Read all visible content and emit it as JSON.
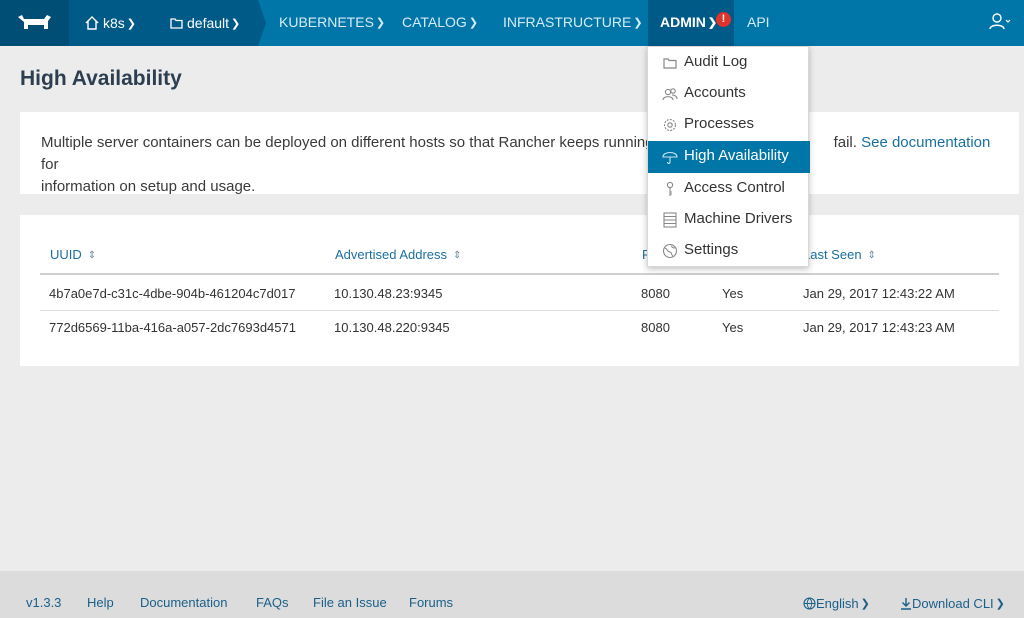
{
  "nav": {
    "environment": "k8s",
    "stack": "default",
    "items": [
      "KUBERNETES",
      "CATALOG",
      "INFRASTRUCTURE",
      "ADMIN",
      "API"
    ],
    "admin_alert": "!",
    "brand_color": "#0075a8"
  },
  "page": {
    "title": "High Availability"
  },
  "info": {
    "text_before": "Multiple server containers can be deployed on different hosts so that Rancher keeps running",
    "text_after": "fail.",
    "link": "See documentation",
    "text_end": "for",
    "line2": "information on setup and usage."
  },
  "table": {
    "headers": [
      "UUID",
      "Advertised Address",
      "P",
      "",
      "Last Seen"
    ],
    "rows": [
      {
        "uuid": "4b7a0e7d-c31c-4dbe-904b-461204c7d017",
        "address": "10.130.48.23:9345",
        "port": "8080",
        "clustered": "Yes",
        "last_seen": "Jan 29, 2017 12:43:22 AM"
      },
      {
        "uuid": "772d6569-11ba-416a-a057-2dc7693d4571",
        "address": "10.130.48.220:9345",
        "port": "8080",
        "clustered": "Yes",
        "last_seen": "Jan 29, 2017 12:43:23 AM"
      }
    ]
  },
  "admin_menu": {
    "items": [
      {
        "label": "Audit Log",
        "icon": "folder-icon"
      },
      {
        "label": "Accounts",
        "icon": "users-icon"
      },
      {
        "label": "Processes",
        "icon": "gear-icon"
      },
      {
        "label": "High Availability",
        "icon": "umbrella-icon"
      },
      {
        "label": "Access Control",
        "icon": "key-icon"
      },
      {
        "label": "Machine Drivers",
        "icon": "server-icon"
      },
      {
        "label": "Settings",
        "icon": "globe-icon"
      }
    ],
    "active_index": 3
  },
  "footer": {
    "version": "v1.3.3",
    "help": "Help",
    "documentation": "Documentation",
    "faqs": "FAQs",
    "file_issue": "File an Issue",
    "forums": "Forums",
    "language": "English",
    "download_cli": "Download CLI"
  }
}
